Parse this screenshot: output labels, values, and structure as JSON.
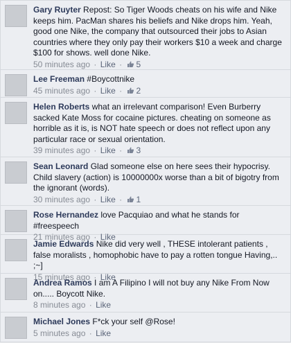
{
  "comments": [
    {
      "author": "Gary Ruyter",
      "text": "Repost: So Tiger Woods cheats on his wife and Nike keeps him. PacMan shares his beliefs and Nike drops him. Yeah, good one Nike, the company that outsourced their jobs to Asian countries where they only pay their workers $10 a week and charge $100 for shows. well done Nike.",
      "time": "50 minutes ago",
      "like_label": "Like",
      "likes": "5"
    },
    {
      "author": "Lee Freeman",
      "text": "#Boycottnike",
      "time": "45 minutes ago",
      "like_label": "Like",
      "likes": "2"
    },
    {
      "author": "Helen Roberts",
      "text": "what an irrelevant comparison! Even Burberry sacked Kate Moss for cocaine pictures. cheating on someone as horrible as it is, is NOT hate speech or does not reflect upon any particular race or sexual orientation.",
      "time": "39 minutes ago",
      "like_label": "Like",
      "likes": "3"
    },
    {
      "author": "Sean Leonard",
      "text": "Glad someone else on here sees their hypocrisy. Child slavery (action) is 10000000x worse than a bit of bigotry from the ignorant (words).",
      "time": "30 minutes ago",
      "like_label": "Like",
      "likes": "1"
    },
    {
      "author": "Rose Hernandez",
      "text": "love Pacquiao and what he stands for #freespeech",
      "time": "21 minutes ago",
      "like_label": "Like",
      "likes": ""
    },
    {
      "author": "Jamie Edwards",
      "text": "Nike did very well , THESE intolerant patients , false moralists , homophobic have to pay a rotten tongue Having,.. ;~]",
      "time": "15 minutes ago",
      "like_label": "Like",
      "likes": ""
    },
    {
      "author": "Andrea Ramos",
      "text": "I am A Filipino I will not buy any Nike From Now on..... Boycott Nike.",
      "time": "8 minutes ago",
      "like_label": "Like",
      "likes": ""
    },
    {
      "author": "Michael Jones",
      "text": "F*ck your self @Rose!",
      "time": "5 minutes ago",
      "like_label": "Like",
      "likes": ""
    }
  ],
  "separator": "·",
  "icons": {
    "like_count": "thumbs-up-icon",
    "avatar": "default-avatar"
  },
  "colors": {
    "author": "#2d3a5a",
    "meta": "#868b94",
    "background": "#eceef2"
  }
}
